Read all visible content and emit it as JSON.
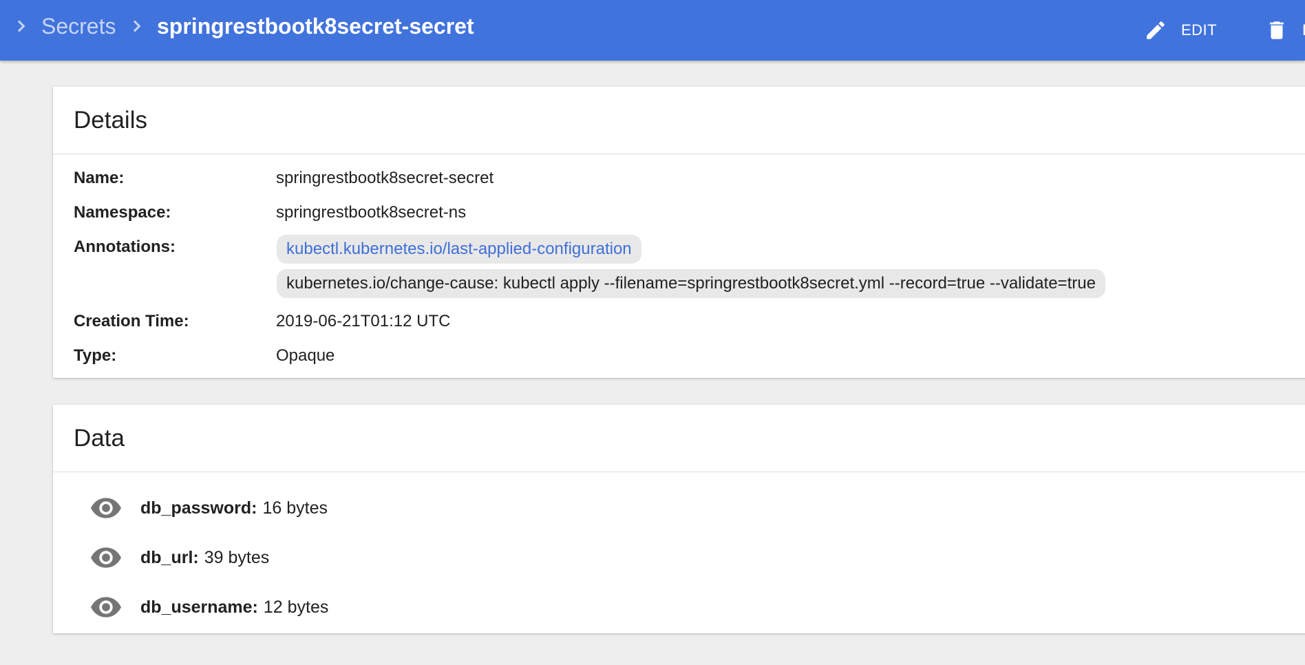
{
  "colors": {
    "toolbar": "#4173dd",
    "link": "#3f6fd8",
    "chip": "#e8e8e8"
  },
  "breadcrumb": {
    "parent": "Secrets",
    "current": "springrestbootk8secret-secret"
  },
  "actions": {
    "edit_label": "EDIT",
    "edit_icon": "pencil-icon",
    "delete_label": "D",
    "delete_icon": "trash-icon"
  },
  "details": {
    "title": "Details",
    "name_label": "Name:",
    "name_value": "springrestbootk8secret-secret",
    "namespace_label": "Namespace:",
    "namespace_value": "springrestbootk8secret-ns",
    "annotations_label": "Annotations:",
    "annotation_link": "kubectl.kubernetes.io/last-applied-configuration",
    "annotation_change_cause": "kubernetes.io/change-cause:  kubectl apply --filename=springrestbootk8secret.yml --record=true --validate=true",
    "creation_label": "Creation Time:",
    "creation_value": "2019-06-21T01:12 UTC",
    "type_label": "Type:",
    "type_value": "Opaque"
  },
  "data": {
    "title": "Data",
    "items": [
      {
        "key": "db_password:",
        "value": "16 bytes",
        "icon": "eye-icon"
      },
      {
        "key": "db_url:",
        "value": "39 bytes",
        "icon": "eye-icon"
      },
      {
        "key": "db_username:",
        "value": "12 bytes",
        "icon": "eye-icon"
      }
    ]
  }
}
